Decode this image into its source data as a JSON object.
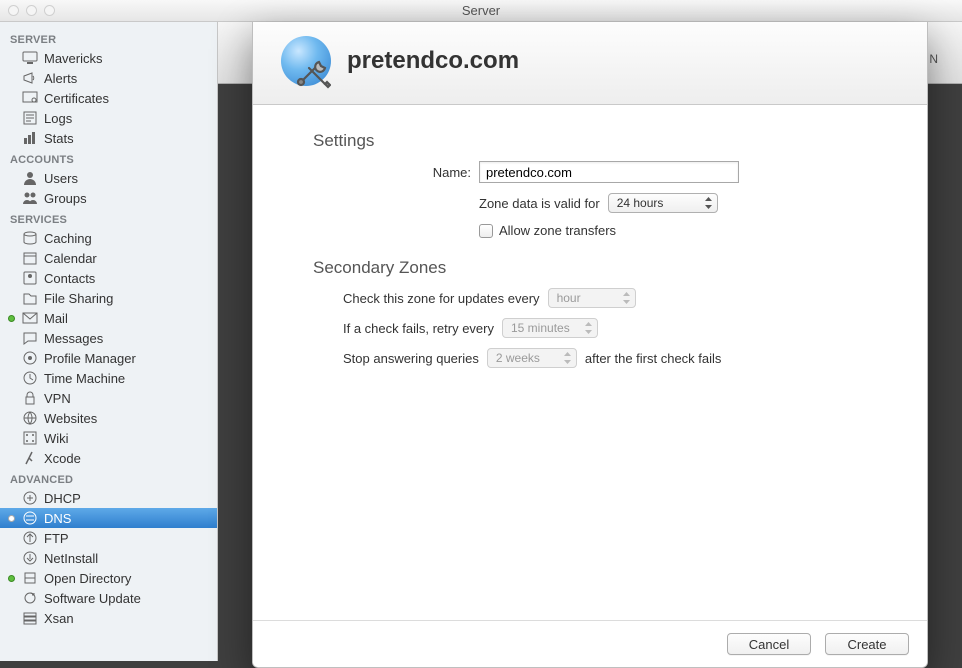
{
  "window": {
    "title": "Server"
  },
  "sidebar": {
    "server_header": "SERVER",
    "server_items": [
      {
        "label": "Mavericks",
        "icon": "monitor-icon"
      },
      {
        "label": "Alerts",
        "icon": "megaphone-icon"
      },
      {
        "label": "Certificates",
        "icon": "certificate-icon"
      },
      {
        "label": "Logs",
        "icon": "logs-icon"
      },
      {
        "label": "Stats",
        "icon": "stats-icon"
      }
    ],
    "accounts_header": "ACCOUNTS",
    "accounts_items": [
      {
        "label": "Users",
        "icon": "user-icon"
      },
      {
        "label": "Groups",
        "icon": "group-icon"
      }
    ],
    "services_header": "SERVICES",
    "services_items": [
      {
        "label": "Caching",
        "icon": "caching-icon",
        "dot": null
      },
      {
        "label": "Calendar",
        "icon": "calendar-icon",
        "dot": null
      },
      {
        "label": "Contacts",
        "icon": "contacts-icon",
        "dot": null
      },
      {
        "label": "File Sharing",
        "icon": "filesharing-icon",
        "dot": null
      },
      {
        "label": "Mail",
        "icon": "mail-icon",
        "dot": "green"
      },
      {
        "label": "Messages",
        "icon": "messages-icon",
        "dot": null
      },
      {
        "label": "Profile Manager",
        "icon": "profilemanager-icon",
        "dot": null
      },
      {
        "label": "Time Machine",
        "icon": "timemachine-icon",
        "dot": null
      },
      {
        "label": "VPN",
        "icon": "vpn-icon",
        "dot": null
      },
      {
        "label": "Websites",
        "icon": "websites-icon",
        "dot": null
      },
      {
        "label": "Wiki",
        "icon": "wiki-icon",
        "dot": null
      },
      {
        "label": "Xcode",
        "icon": "xcode-icon",
        "dot": null
      }
    ],
    "advanced_header": "ADVANCED",
    "advanced_items": [
      {
        "label": "DHCP",
        "icon": "dhcp-icon",
        "dot": null,
        "selected": false
      },
      {
        "label": "DNS",
        "icon": "dns-icon",
        "dot": "white",
        "selected": true
      },
      {
        "label": "FTP",
        "icon": "ftp-icon",
        "dot": null,
        "selected": false
      },
      {
        "label": "NetInstall",
        "icon": "netinstall-icon",
        "dot": null,
        "selected": false
      },
      {
        "label": "Open Directory",
        "icon": "opendirectory-icon",
        "dot": "green",
        "selected": false
      },
      {
        "label": "Software Update",
        "icon": "softwareupdate-icon",
        "dot": null,
        "selected": false
      },
      {
        "label": "Xsan",
        "icon": "xsan-icon",
        "dot": null,
        "selected": false
      }
    ]
  },
  "bg": {
    "letter": "N"
  },
  "modal": {
    "title": "pretendco.com",
    "settings": {
      "heading": "Settings",
      "name_label": "Name:",
      "name_value": "pretendco.com",
      "zone_valid_label": "Zone data is valid for",
      "zone_valid_value": "24 hours",
      "allow_zone_label": "Allow zone transfers",
      "allow_zone_checked": false
    },
    "secondary": {
      "heading": "Secondary Zones",
      "check_label": "Check this zone for updates every",
      "check_value": "hour",
      "retry_label": "If a check fails, retry every",
      "retry_value": "15 minutes",
      "stop_label_pre": "Stop answering queries",
      "stop_value": "2 weeks",
      "stop_label_post": "after the first check fails"
    },
    "footer": {
      "cancel": "Cancel",
      "create": "Create"
    }
  }
}
